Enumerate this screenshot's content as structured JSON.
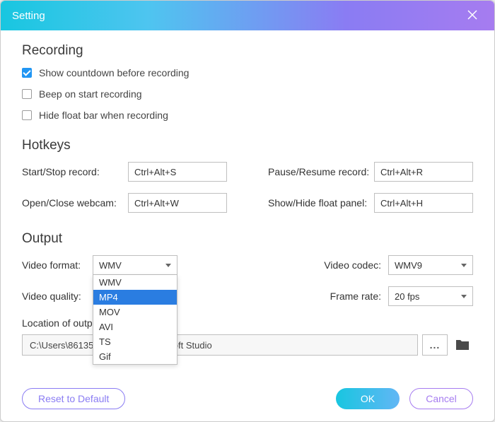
{
  "title": "Setting",
  "recording": {
    "heading": "Recording",
    "options": [
      {
        "label": "Show countdown before recording",
        "checked": true
      },
      {
        "label": "Beep on start recording",
        "checked": false
      },
      {
        "label": "Hide float bar when recording",
        "checked": false
      }
    ]
  },
  "hotkeys": {
    "heading": "Hotkeys",
    "start_stop_label": "Start/Stop record:",
    "start_stop_value": "Ctrl+Alt+S",
    "pause_resume_label": "Pause/Resume record:",
    "pause_resume_value": "Ctrl+Alt+R",
    "open_close_webcam_label": "Open/Close webcam:",
    "open_close_webcam_value": "Ctrl+Alt+W",
    "show_hide_panel_label": "Show/Hide float panel:",
    "show_hide_panel_value": "Ctrl+Alt+H"
  },
  "output": {
    "heading": "Output",
    "video_format_label": "Video format:",
    "video_format_value": "WMV",
    "video_format_options": [
      "WMV",
      "MP4",
      "MOV",
      "AVI",
      "TS",
      "Gif"
    ],
    "video_format_highlight": "MP4",
    "video_codec_label": "Video codec:",
    "video_codec_value": "WMV9",
    "video_quality_label": "Video quality:",
    "frame_rate_label": "Frame rate:",
    "frame_rate_value": "20 fps",
    "location_label": "Location of output files:",
    "location_value": "C:\\Users\\86135\\Documents\\Vidbesoft Studio",
    "browse_label": "..."
  },
  "buttons": {
    "reset": "Reset to Default",
    "ok": "OK",
    "cancel": "Cancel"
  }
}
